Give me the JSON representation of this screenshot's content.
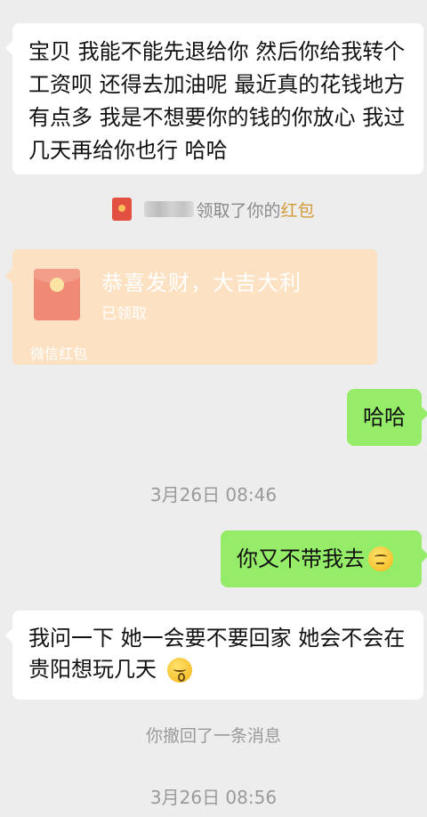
{
  "messages": {
    "msg1": "宝贝 我能不能先退给你 然后你给我转个工资呗 还得去加油呢 最近真的花钱地方有点多 我是不想要你的钱的你放心 我过几天再给你也行 哈哈",
    "redpacket_notice_prefix": "领取了你的",
    "redpacket_notice_link": "红包",
    "redpacket_title": "恭喜发财，大吉大利",
    "redpacket_status": "已领取",
    "redpacket_footer": "微信红包",
    "msg2": "哈哈",
    "time1": "3月26日 08:46",
    "msg3": "你又不带我去",
    "msg4": "我问一下 她一会要不要回家  她会不会在贵阳想玩几天",
    "recall": "你撤回了一条消息",
    "time2": "3月26日 08:56"
  },
  "colors": {
    "background": "#ededed",
    "bubble_self": "#95ec69",
    "bubble_other": "#ffffff",
    "redpacket_card": "#fde1c3",
    "redpacket_link": "#d49a3a"
  },
  "icons": {
    "redpacket_small": "red-envelope-icon",
    "redpacket_large": "red-envelope-icon",
    "emoji_msg3": "thinking-face-emoji",
    "emoji_msg4": "kissing-face-emoji"
  }
}
